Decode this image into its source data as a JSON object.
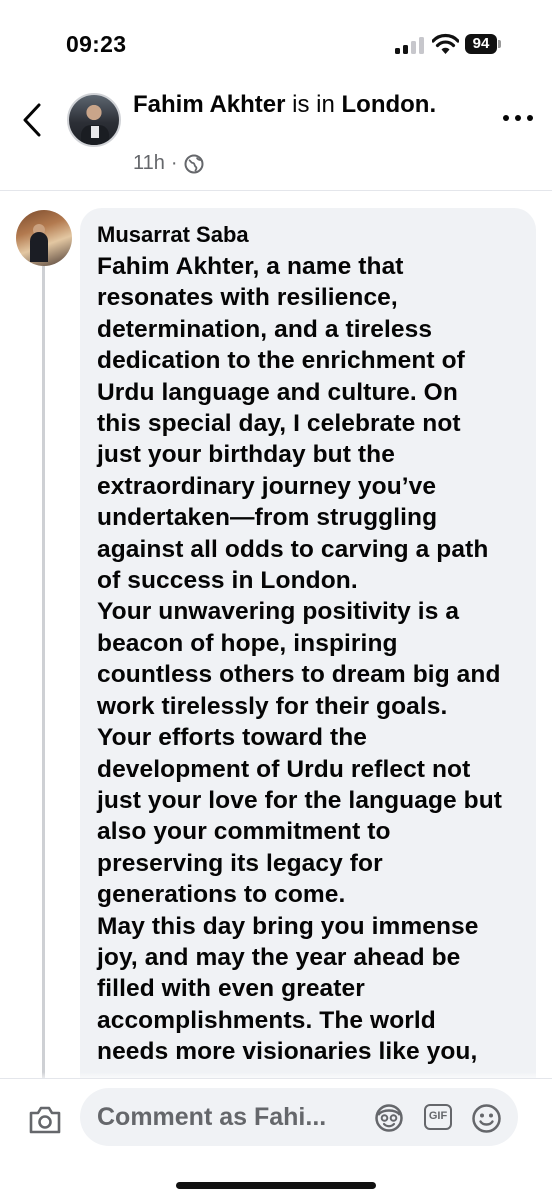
{
  "status_bar": {
    "time": "09:23",
    "battery": "94"
  },
  "header": {
    "author": "Fahim Akhter",
    "connector": " is in ",
    "location": "London.",
    "time_ago": "11h",
    "separator": "·"
  },
  "comment": {
    "author": "Musarrat Saba",
    "lines": [
      "Fahim Akhter, a name that",
      "resonates with resilience,",
      "determination, and a tireless",
      "dedication to the enrichment of",
      "Urdu language and culture. On",
      "this special day, I celebrate not",
      "just your birthday but the",
      "extraordinary journey you’ve",
      "undertaken—from struggling",
      "against all odds to carving a path",
      "of success in London.",
      "Your unwavering positivity is a",
      "beacon of hope, inspiring",
      "countless others to dream big and",
      "work tirelessly for their goals.",
      "Your efforts toward the",
      "development of Urdu reflect not",
      "just your love for the language but",
      "also your commitment to",
      "preserving its legacy for",
      "generations to come.",
      "May this day bring you immense",
      "joy, and may the year ahead be",
      "filled with even greater",
      "accomplishments. The world",
      "needs more visionaries like you,"
    ]
  },
  "composer": {
    "placeholder": "Comment as Fahi...",
    "gif_label": "GIF"
  },
  "icons": {
    "back": "chevron-left-icon",
    "more": "more-horizontal-icon",
    "audience": "globe-icon",
    "camera": "camera-icon",
    "avatar_sticker": "avatar-sticker-icon",
    "gif": "gif-icon",
    "emoji": "smiley-icon"
  },
  "colors": {
    "secondary_text": "#65676b",
    "bubble": "#f0f2f5",
    "text": "#050505"
  }
}
